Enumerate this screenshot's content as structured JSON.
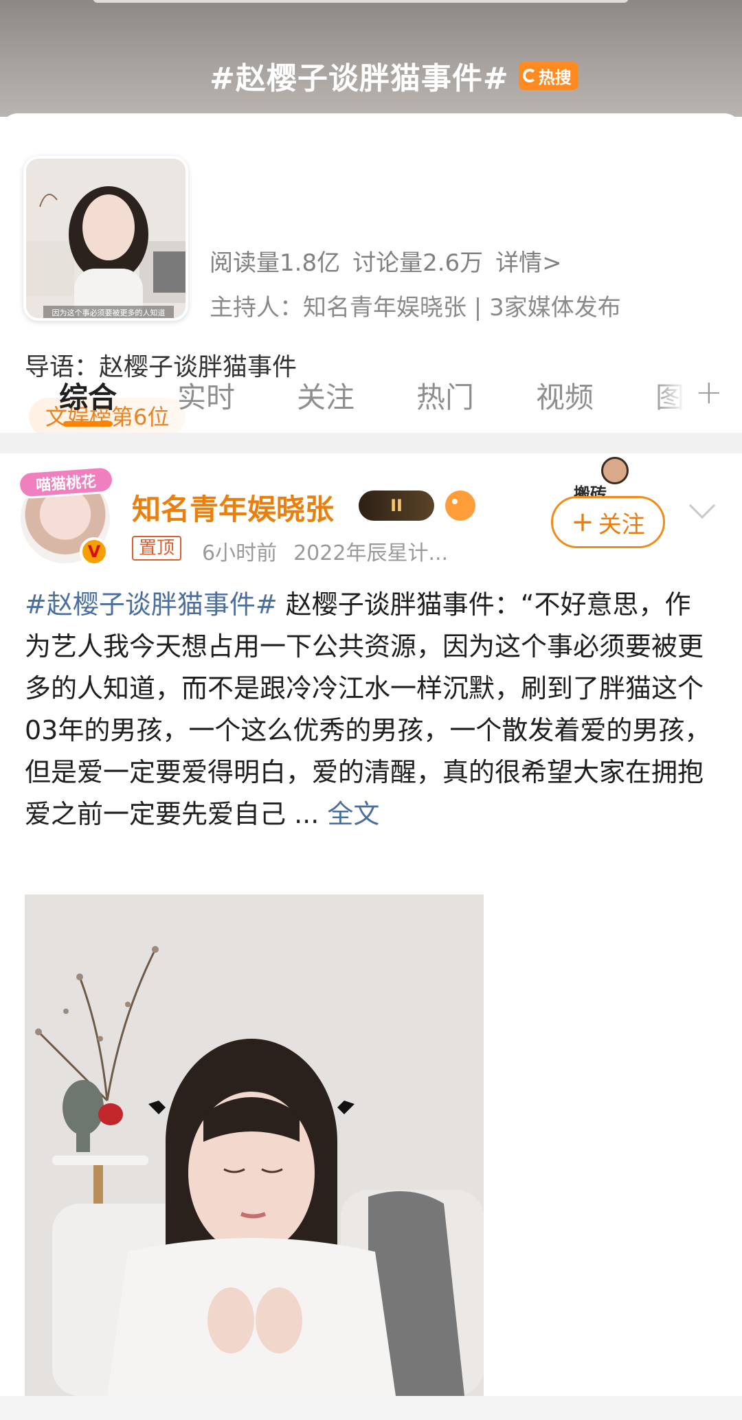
{
  "topic": {
    "title": "#赵樱子谈胖猫事件#",
    "hot_badge": "热搜",
    "reads": "阅读量1.8亿",
    "discussions": "讨论量2.6万",
    "details": "详情>",
    "host_line": "主持人：知名青年娱晓张 | 3家媒体发布",
    "intro": "导语：赵樱子谈胖猫事件",
    "rank": "文娱榜第6位",
    "thumb_caption": "因为这个事必须要被更多的人知道"
  },
  "tabs": [
    "综合",
    "实时",
    "关注",
    "热门",
    "视频",
    "图"
  ],
  "tabs_plus": "+",
  "post": {
    "avatar_sticker": "喵猫桃花",
    "username": "知名青年娱晓张",
    "level_badge": "II",
    "pin_label": "置顶",
    "time": "6小时前",
    "source": "2022年辰星计...",
    "sticker_text": "搬砖",
    "follow_label": "关注",
    "hashtag": "#赵樱子谈胖猫事件#",
    "body": " 赵樱子谈胖猫事件：“不好意思，作为艺人我今天想占用一下公共资源，因为这个事必须要被更多的人知道，而不是跟冷冷江水一样沉默，刷到了胖猫这个03年的男孩，一个这么优秀的男孩，一个散发着爱的男孩，但是爱一定要爱得明白，爱的清醒，真的很希望大家在拥抱爱之前一定要先爱自己 ... ",
    "full_text_link": "全文"
  },
  "colors": {
    "accent_orange": "#ff8200",
    "link_blue": "#4b6f9c",
    "username_orange": "#e9800e"
  }
}
